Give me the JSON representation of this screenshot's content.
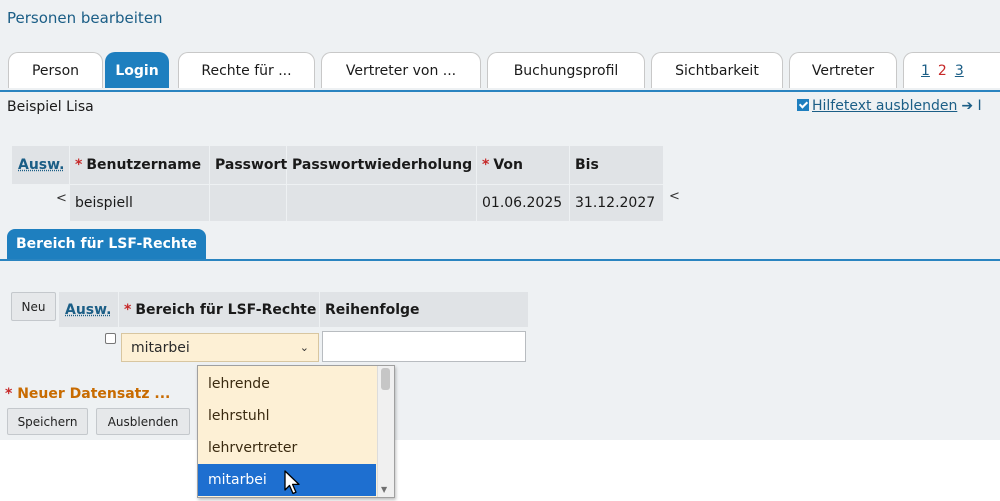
{
  "page": {
    "title": "Personen bearbeiten"
  },
  "tabs": [
    {
      "label": "Person"
    },
    {
      "label": "Login",
      "active": true
    },
    {
      "label": "Rechte für ..."
    },
    {
      "label": "Vertreter von ..."
    },
    {
      "label": "Buchungsprofil"
    },
    {
      "label": "Sichtbarkeit"
    },
    {
      "label": "Vertreter"
    }
  ],
  "tab_pages": {
    "p1": "1",
    "p2": "2",
    "p3": "3",
    "current": "2"
  },
  "person": {
    "name": "Beispiel  Lisa"
  },
  "help": {
    "label": "Hilfetext ausblenden",
    "checked": true,
    "arrow": "➔",
    "next": "I"
  },
  "login_table": {
    "headers": {
      "ausw": "Ausw.",
      "benutzername": "Benutzername",
      "passwort": "Passwort",
      "passwortwiederholung": "Passwortwiederholung",
      "von": "Von",
      "bis": "Bis"
    },
    "row": {
      "lt_left": "<",
      "benutzername": "beispiell",
      "passwort": "",
      "passwortwiederholung": "",
      "von": "01.06.2025",
      "bis": "31.12.2027",
      "lt_right": "<"
    }
  },
  "section": {
    "title": "Bereich für LSF-Rechte"
  },
  "lsf_table": {
    "new_button": "Neu",
    "headers": {
      "ausw": "Ausw.",
      "bereich": "Bereich für LSF-Rechte",
      "reihenfolge": "Reihenfolge"
    },
    "row": {
      "checked": false,
      "bereich_value": "mitarbei",
      "reihenfolge_value": ""
    }
  },
  "new_record": {
    "label": "Neuer Datensatz ..."
  },
  "buttons": {
    "save": "Speichern",
    "hide": "Ausblenden"
  },
  "dropdown": {
    "options": [
      "lehrende",
      "lehrstuhl",
      "lehrvertreter",
      "mitarbei"
    ],
    "selected": "mitarbei"
  },
  "colors": {
    "accent": "#1e7fbf",
    "required": "#c62828",
    "select_bg": "#fdf0d5",
    "highlight": "#1e6fd0"
  },
  "icons": {
    "select_chevron": "chevron-down-icon",
    "help_checkbox": "checkbox-checked-icon",
    "help_arrow": "arrow-right-icon",
    "pointer": "mouse-cursor-icon"
  }
}
